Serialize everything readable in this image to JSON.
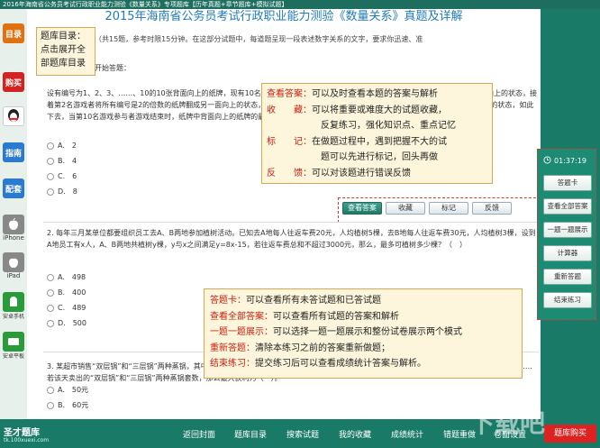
{
  "window": {
    "title": "2016年海南省公务员考试行政职业能力测验《数量关系》专项题库【历年真题+章节题库+模拟试题】"
  },
  "sidebar": {
    "items": [
      {
        "label": "目录",
        "icon": "catalog-icon",
        "color": "#e07010"
      },
      {
        "label": "购买",
        "icon": "buy-icon",
        "color": "#d22222"
      },
      {
        "label": "",
        "icon": "qq-icon",
        "color": "#e8a000"
      },
      {
        "label": "指南",
        "icon": "guide-icon",
        "color": "#2a7ad0"
      },
      {
        "label": "配套",
        "icon": "bundle-icon",
        "color": "#2a7ad0"
      },
      {
        "label": "iPhone",
        "icon": "apple-icon",
        "color": "#888888"
      },
      {
        "label": "iPad",
        "icon": "ipad-icon",
        "color": "#888888"
      },
      {
        "label": "安卓手机",
        "icon": "android-phone-icon",
        "color": "#2a9a3a"
      },
      {
        "label": "安卓平板",
        "icon": "android-tablet-icon",
        "color": "#2a9a3a"
      }
    ]
  },
  "main": {
    "title": "2015年海南省公务员考试行政职业能力测验《数量关系》真题及详解",
    "section_intro": "（共15题，参考时限15分钟。在这部分试题中，每道题呈现一段表述数字关系的文字，要求你迅速、准",
    "start_label": "开始答题：",
    "questions": [
      {
        "text": "设有编号为1、2、3、……、10的10张背面向上的纸牌，现有10名游戏参与者，第1名游戏参与者将所有编号是1的倍数的纸牌翻成另一面向上的状态，接着第2名游戏者将所有编号是2的倍数的纸牌翻成另一面向上的状态，……，第n名游戏参与者，将所有编号是n的倍数的纸牌翻成另一面向上的状态，如此下去，当第10名游戏参与者游戏结束时，纸牌中背面向上的纸牌的最大编号与最小编号的差是（　）。",
        "options": [
          "A.　2",
          "B.　4",
          "C.　6",
          "D.　8"
        ]
      },
      {
        "text": "2. 每年三月某单位都要组织员工去A、B两地参加植树活动。已知去A地每人往返车费20元，人均植树5棵，去B地每人往返车费30元，人均植树3棵，设到A地员工有x人，A、B两地共植树y棵，y与x之间满足y=8x-15，若往返车费总和不超过3000元，那么，最多可植树多少棵？（　）",
        "options": [
          "A.　498",
          "B.　400",
          "C.　489",
          "D.　500"
        ]
      },
      {
        "text": "3. 某超市销售“双层锅”和“三层锅”两种蒸锅，其中1个“双层锅”和1个“三层锅”的售价为……元，某天该超市共卖出了1个锅，并且每卖一个“双层锅”……若该天卖出的“双层锅”和“三层锅”两种蒸锅套数，那么最大获利为（　）。",
        "options": [
          "A.　50元",
          "B.　60元"
        ]
      }
    ],
    "question_buttons": [
      "查看答案",
      "收藏",
      "标记",
      "反馈"
    ]
  },
  "tooltips": {
    "catalog": {
      "lines": [
        "题库目录：",
        "点击展开全",
        "部题库目录"
      ]
    },
    "question_tools": {
      "rows": [
        {
          "key": "查看答案：",
          "desc": "可以及时查看本题的答案与解析"
        },
        {
          "key": "收　　藏：",
          "desc": "可以将重要或难度大的试题收藏，"
        },
        {
          "key": "",
          "desc": "反复练习，强化知识点、重点记忆"
        },
        {
          "key": "标　　记：",
          "desc": "在做题过程中，遇到把握不大的试"
        },
        {
          "key": "",
          "desc": "题可以先进行标记，回头再做"
        },
        {
          "key": "反　　馈：",
          "desc": "可以对该题进行错误反馈"
        }
      ]
    },
    "panel_tools": {
      "rows": [
        {
          "key": "答题卡：",
          "desc": "可以查看所有未答试题和已答试题"
        },
        {
          "key": "查看全部答案：",
          "desc": "可以查看所有试题的答案和解析"
        },
        {
          "key": "一题一题展示：",
          "desc": "可以选择一题一题展示和整份试卷展示两个模式"
        },
        {
          "key": "重新答题：",
          "desc": "清除本练习之前的答案重新做题；"
        },
        {
          "key": "结束练习：",
          "desc": "提交练习后可以查看成绩统计答案与解析。"
        }
      ]
    }
  },
  "right_panel": {
    "timer": "01:37:19",
    "buttons": [
      "答题卡",
      "查看全部答案",
      "一题一题展示",
      "计算器",
      "重新答题",
      "结束练习"
    ]
  },
  "bottom_bar": {
    "logo": "圣才题库",
    "logo_sub": "tk.100xuexi.com",
    "nav": [
      "返回封面",
      "题库目录",
      "搜索试题",
      "我的收藏",
      "成绩统计",
      "错题重做",
      "卷面设置"
    ],
    "buy": "题库购买"
  },
  "watermark": "下载吧"
}
